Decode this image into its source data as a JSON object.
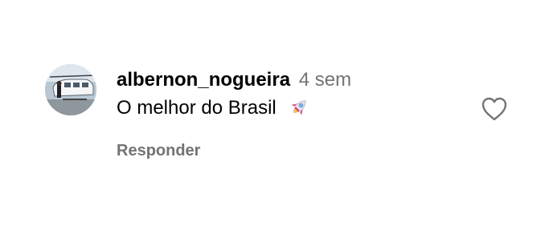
{
  "comment": {
    "username": "albernon_nogueira",
    "time": "4 sem",
    "text": "O melhor do Brasil",
    "emoji": "rocket-icon",
    "reply_label": "Responder",
    "like_icon": "heart-icon",
    "avatar_alt": "avatar"
  },
  "colors": {
    "text_primary": "#000000",
    "text_secondary": "#737373"
  }
}
